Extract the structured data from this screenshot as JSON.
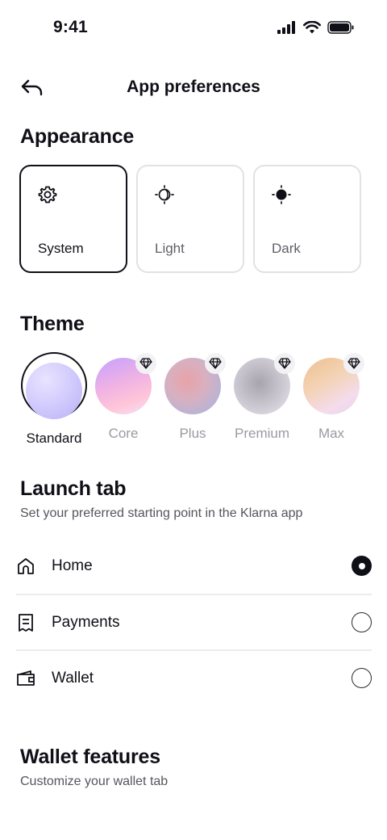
{
  "status_bar": {
    "time": "9:41"
  },
  "header": {
    "title": "App preferences"
  },
  "appearance": {
    "title": "Appearance",
    "options": [
      {
        "label": "System",
        "icon": "gear-icon",
        "selected": true
      },
      {
        "label": "Light",
        "icon": "light-mode-icon",
        "selected": false
      },
      {
        "label": "Dark",
        "icon": "dark-mode-icon",
        "selected": false
      }
    ]
  },
  "theme": {
    "title": "Theme",
    "options": [
      {
        "label": "Standard",
        "selected": true,
        "premium": false,
        "colors": [
          "#c9c4ff",
          "#e8e4ff"
        ]
      },
      {
        "label": "Core",
        "selected": false,
        "premium": true,
        "colors": [
          "#c9a8ff",
          "#ffb8d2"
        ]
      },
      {
        "label": "Plus",
        "selected": false,
        "premium": true,
        "colors": [
          "#e8a8a8",
          "#b8b8e0"
        ]
      },
      {
        "label": "Premium",
        "selected": false,
        "premium": true,
        "colors": [
          "#b8b4be",
          "#e6e4ea"
        ]
      },
      {
        "label": "Max",
        "selected": false,
        "premium": true,
        "colors": [
          "#f0c89a",
          "#f2d6e8"
        ]
      }
    ]
  },
  "launch_tab": {
    "title": "Launch tab",
    "subtitle": "Set your preferred starting point in the Klarna app",
    "options": [
      {
        "label": "Home",
        "icon": "home-icon",
        "selected": true
      },
      {
        "label": "Payments",
        "icon": "receipt-icon",
        "selected": false
      },
      {
        "label": "Wallet",
        "icon": "wallet-icon",
        "selected": false
      }
    ]
  },
  "wallet_features": {
    "title": "Wallet features",
    "subtitle": "Customize your wallet tab"
  }
}
